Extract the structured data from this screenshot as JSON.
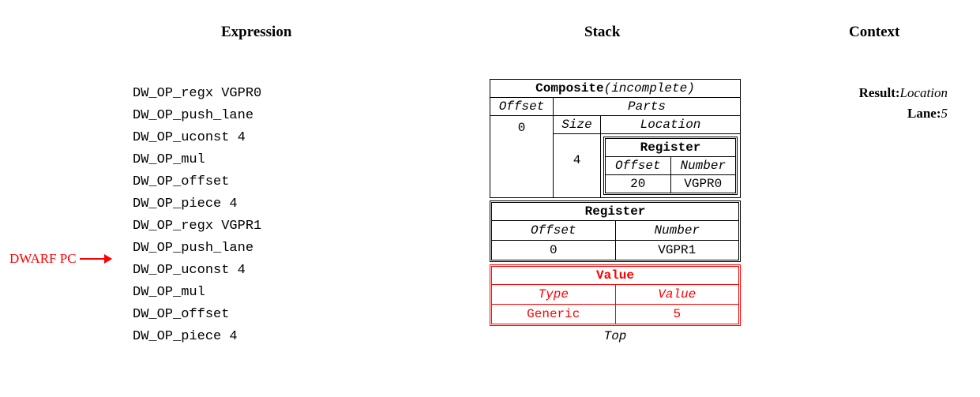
{
  "headers": {
    "expr": "Expression",
    "stack": "Stack",
    "context": "Context"
  },
  "dwarf_pc_label": "DWARF PC",
  "expression": [
    "DW_OP_regx VGPR0",
    "DW_OP_push_lane",
    "DW_OP_uconst 4",
    "DW_OP_mul",
    "DW_OP_offset",
    "DW_OP_piece 4",
    "DW_OP_regx VGPR1",
    "DW_OP_push_lane",
    "DW_OP_uconst 4",
    "DW_OP_mul",
    "DW_OP_offset",
    "DW_OP_piece 4"
  ],
  "pc_index": 8,
  "stack": {
    "composite": {
      "title": "Composite",
      "status": "(incomplete)",
      "offset_label": "Offset",
      "parts_label": "Parts",
      "size_label": "Size",
      "location_label": "Location",
      "offset_val": "0",
      "size_val": "4",
      "inner_register": {
        "title": "Register",
        "offset_label": "Offset",
        "number_label": "Number",
        "offset_val": "20",
        "number_val": "VGPR0"
      }
    },
    "register": {
      "title": "Register",
      "offset_label": "Offset",
      "number_label": "Number",
      "offset_val": "0",
      "number_val": "VGPR1"
    },
    "value": {
      "title": "Value",
      "type_label": "Type",
      "value_label": "Value",
      "type_val": "Generic",
      "value_val": "5"
    },
    "top_label": "Top"
  },
  "context": {
    "result_label": "Result:",
    "result_val": "Location",
    "lane_label": "Lane:",
    "lane_val": "5"
  }
}
